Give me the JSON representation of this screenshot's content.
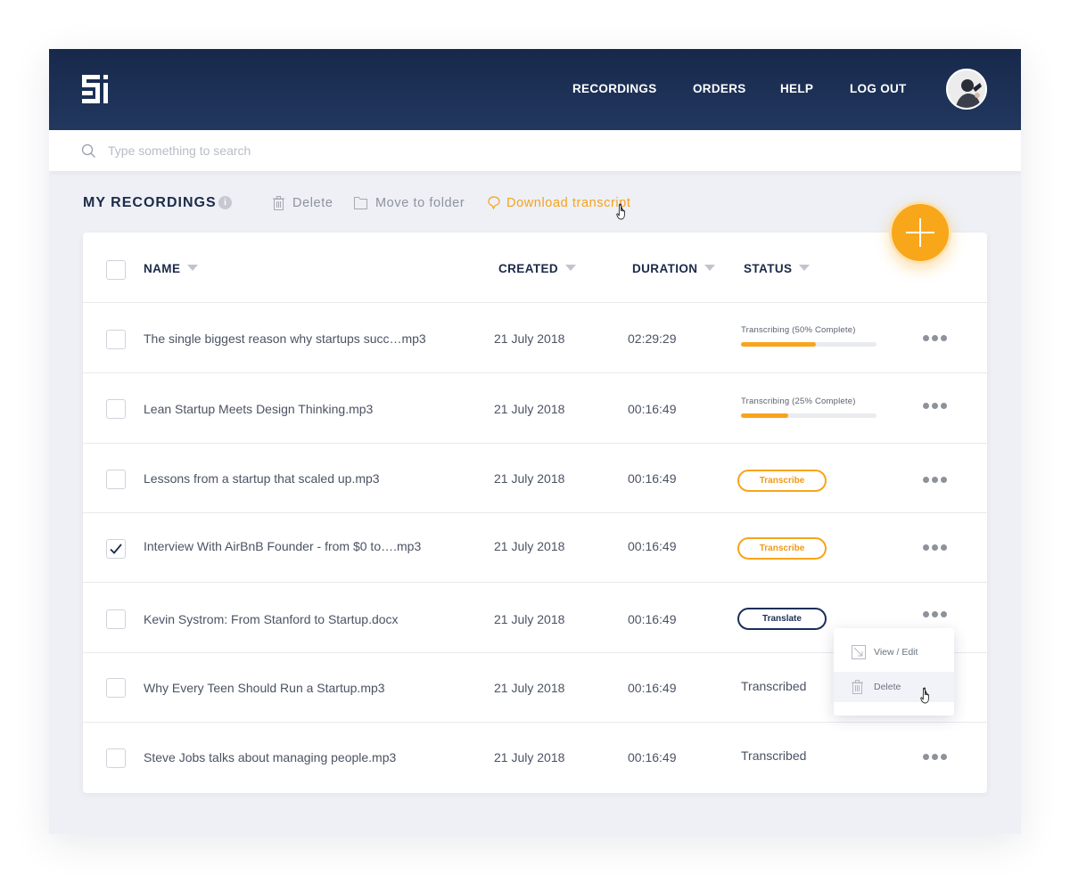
{
  "nav": {
    "items": [
      {
        "label": "RECORDINGS"
      },
      {
        "label": "ORDERS"
      },
      {
        "label": "HELP"
      },
      {
        "label": "LOG OUT"
      }
    ]
  },
  "search": {
    "placeholder": "Type something to search"
  },
  "page": {
    "title": "MY RECORDINGS",
    "info_glyph": "i",
    "actions": {
      "delete": "Delete",
      "move": "Move to folder",
      "download": "Download transcript"
    }
  },
  "table": {
    "columns": {
      "name": "NAME",
      "created": "CREATED",
      "duration": "DURATION",
      "status": "STATUS"
    },
    "rows": [
      {
        "name": "The single biggest reason why startups succ…mp3",
        "created": "21 July 2018",
        "duration": "02:29:29",
        "status_type": "progress",
        "status_label": "Transcribing (50% Complete)",
        "progress": 0.55,
        "checked": false
      },
      {
        "name": "Lean Startup Meets Design Thinking.mp3",
        "created": "21 July 2018",
        "duration": "00:16:49",
        "status_type": "progress",
        "status_label": "Transcribing (25% Complete)",
        "progress": 0.35,
        "checked": false
      },
      {
        "name": "Lessons from a startup that scaled up.mp3",
        "created": "21 July 2018",
        "duration": "00:16:49",
        "status_type": "button",
        "status_label": "Transcribe",
        "checked": false
      },
      {
        "name": "Interview With AirBnB Founder - from $0 to….mp3",
        "created": "21 July 2018",
        "duration": "00:16:49",
        "status_type": "button",
        "status_label": "Transcribe",
        "checked": true
      },
      {
        "name": "Kevin Systrom: From Stanford to Startup.docx",
        "created": "21 July 2018",
        "duration": "00:16:49",
        "status_type": "button-navy",
        "status_label": "Translate",
        "checked": false
      },
      {
        "name": "Why Every Teen Should Run a Startup.mp3",
        "created": "21 July 2018",
        "duration": "00:16:49",
        "status_type": "text",
        "status_label": "Transcribed",
        "checked": false
      },
      {
        "name": "Steve Jobs talks about managing people.mp3",
        "created": "21 July 2018",
        "duration": "00:16:49",
        "status_type": "text",
        "status_label": "Transcribed",
        "checked": false
      }
    ]
  },
  "context_menu": {
    "view_edit": "View / Edit",
    "delete": "Delete"
  },
  "colors": {
    "navy": "#1c2a48",
    "accent_orange": "#f8a41b",
    "background": "#eef0f5"
  },
  "icons": [
    "logo-icon",
    "search-icon",
    "info-icon",
    "trash-icon",
    "folder-icon",
    "tag-icon",
    "plus-icon",
    "more-icon",
    "edit-icon",
    "hand-cursor-icon",
    "checkmark-icon",
    "sort-caret-icon"
  ]
}
